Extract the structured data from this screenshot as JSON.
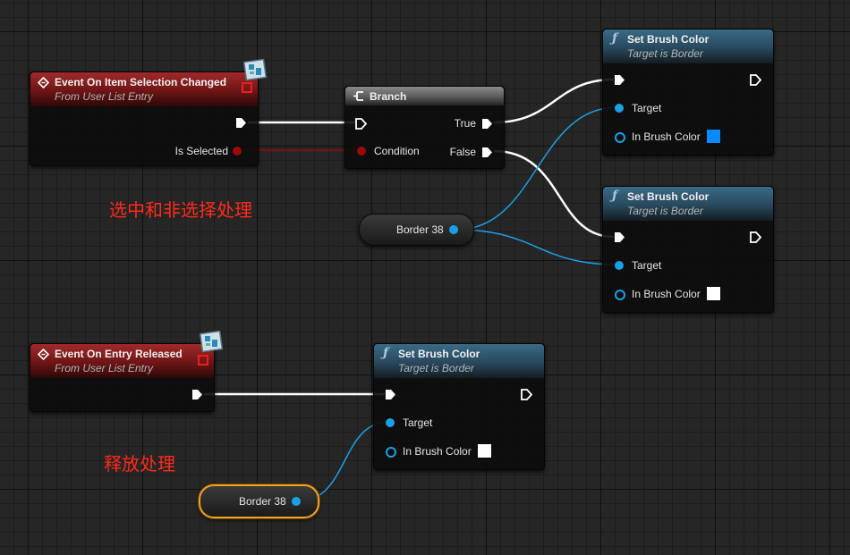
{
  "nodes": {
    "event_selection": {
      "title": "Event On Item Selection Changed",
      "subtitle": "From User List Entry",
      "pin_is_selected": "Is Selected"
    },
    "branch": {
      "title": "Branch",
      "pin_condition": "Condition",
      "pin_true": "True",
      "pin_false": "False"
    },
    "set_brush_1": {
      "title": "Set Brush Color",
      "subtitle": "Target is Border",
      "pin_target": "Target",
      "pin_color": "In Brush Color",
      "color_value": "#0a8aff"
    },
    "set_brush_2": {
      "title": "Set Brush Color",
      "subtitle": "Target is Border",
      "pin_target": "Target",
      "pin_color": "In Brush Color",
      "color_value": "#ffffff"
    },
    "border_var_1": {
      "label": "Border 38"
    },
    "event_released": {
      "title": "Event On Entry Released",
      "subtitle": "From User List Entry"
    },
    "set_brush_3": {
      "title": "Set Brush Color",
      "subtitle": "Target is Border",
      "pin_target": "Target",
      "pin_color": "In Brush Color",
      "color_value": "#ffffff"
    },
    "border_var_2": {
      "label": "Border 38"
    }
  },
  "comments": {
    "selection": "选中和非选择处理",
    "release": "释放处理"
  },
  "colors": {
    "exec_wire": "#ffffff",
    "object_wire": "#1aa0e6",
    "bool_wire": "#9a0a0a",
    "event_header": "#8a1e1e",
    "function_header": "#2e5670",
    "comment_text": "#ff2a1a",
    "selection_outline": "#f0a020"
  }
}
